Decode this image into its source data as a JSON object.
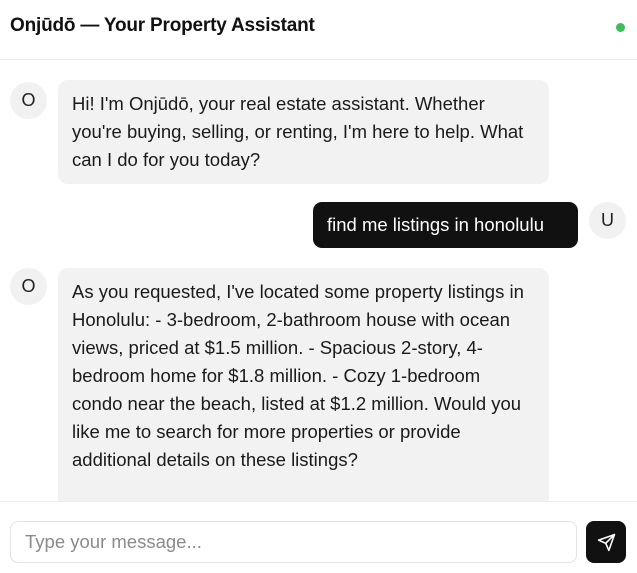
{
  "header": {
    "title": "Onjūdō — Your Property Assistant",
    "status_color": "#3ebd5c"
  },
  "messages": [
    {
      "role": "assistant",
      "avatar": "O",
      "text": "Hi! I'm Onjūdō, your real estate assistant. Whether you're buying, selling, or renting, I'm here to help. What can I do for you today?"
    },
    {
      "role": "user",
      "avatar": "U",
      "text": "find me listings in honolulu"
    },
    {
      "role": "assistant",
      "avatar": "O",
      "text": "As you requested, I've located some property listings in Honolulu: - 3-bedroom, 2-bathroom house with ocean views, priced at $1.5 million. - Spacious 2-story, 4-bedroom home for $1.8 million. - Cozy 1-bedroom condo near the beach, listed at $1.2 million. Would you like me to search for more properties or provide additional details on these listings?"
    }
  ],
  "composer": {
    "placeholder": "Type your message...",
    "value": "",
    "send_icon": "send-icon"
  },
  "colors": {
    "accent": "#111111",
    "assistant_bubble": "#f2f2f2",
    "status": "#3ebd5c"
  }
}
